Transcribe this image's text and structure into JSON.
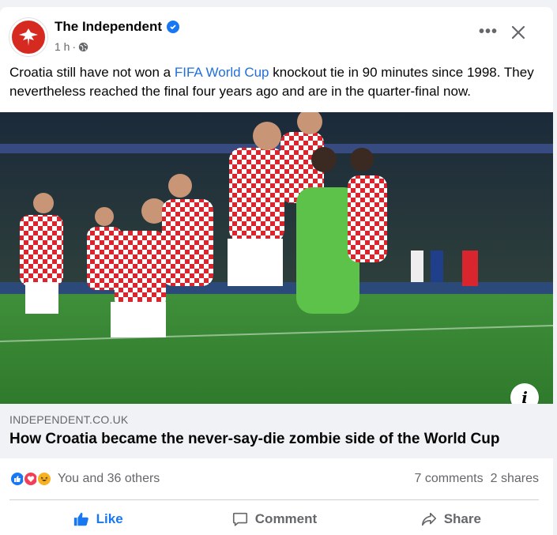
{
  "post": {
    "page_name": "The Independent",
    "verified_icon": "verified-badge-icon",
    "timestamp": "1 h",
    "separator": "·",
    "audience_icon": "globe-icon",
    "text_part1": "Croatia still have not won a ",
    "text_link": "FIFA World Cup",
    "text_part2": " knockout tie in 90 minutes since 1998. They nevertheless reached the final four years ago and are in the quarter-final now.",
    "more_icon": "•••",
    "close_icon": "close-icon"
  },
  "link_preview": {
    "domain": "INDEPENDENT.CO.UK",
    "headline": "How Croatia became the never-say-die zombie side of the World Cup",
    "info_icon": "i"
  },
  "stats": {
    "reaction_icons": [
      "like-reaction-icon",
      "love-reaction-icon",
      "haha-reaction-icon"
    ],
    "reactions_label": "You and 36 others",
    "comments": "7 comments",
    "shares": "2 shares"
  },
  "actions": {
    "like": "Like",
    "comment": "Comment",
    "share": "Share"
  },
  "colors": {
    "brand_blue": "#1877f2",
    "link_blue": "#216fdb",
    "independent_red": "#d6291f",
    "secondary_text": "#65676b"
  }
}
